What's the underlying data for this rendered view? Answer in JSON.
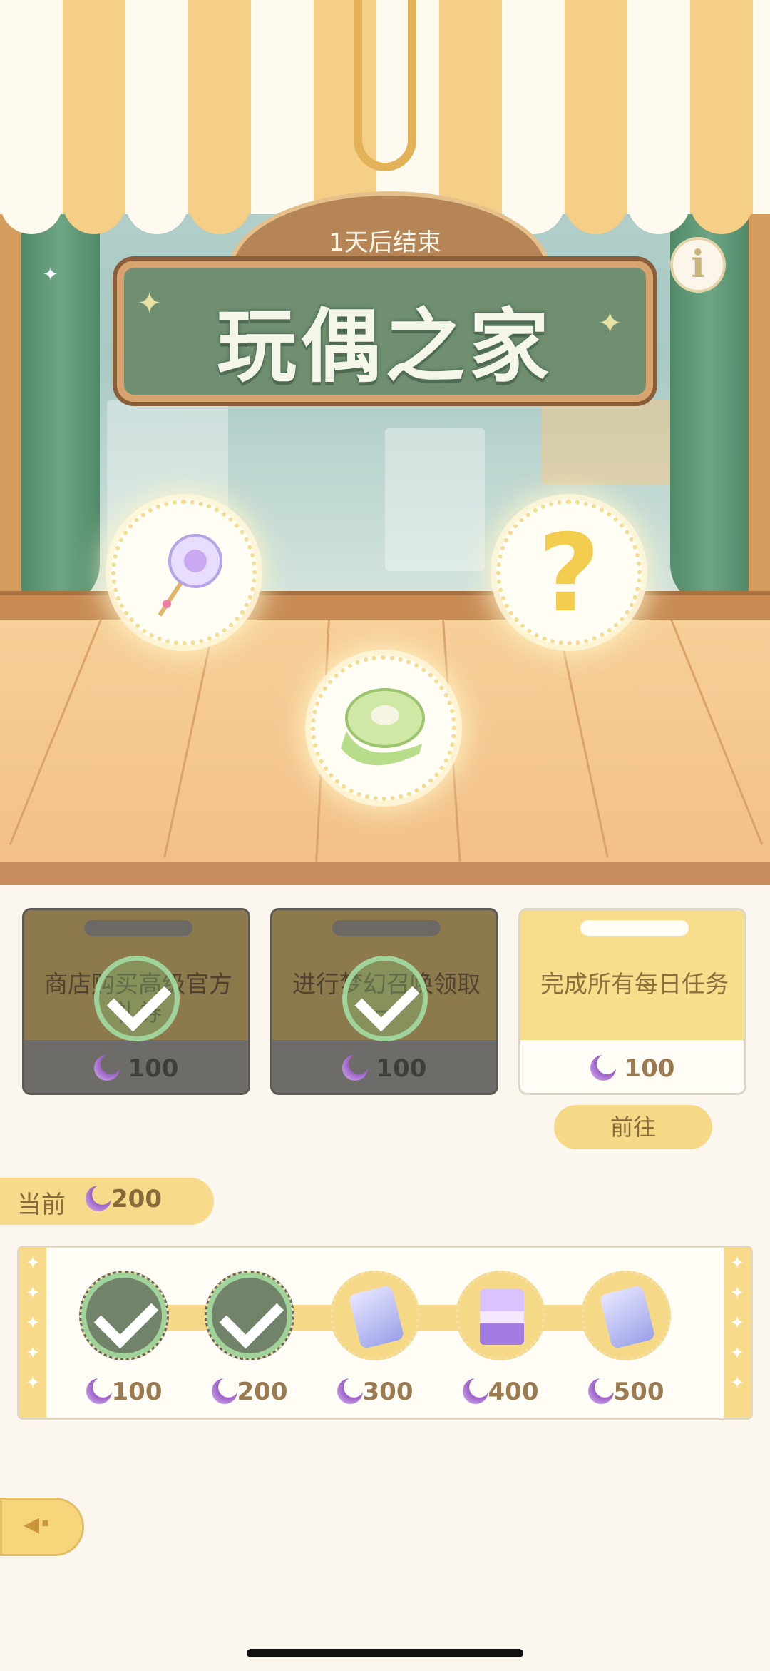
{
  "event": {
    "timer": "1天后结束",
    "title": "玩偶之家"
  },
  "rewards_showcase": [
    {
      "icon": "lollipop-wand-icon"
    },
    {
      "icon": "question-mark-icon",
      "label": "?"
    },
    {
      "icon": "ribbon-spool-icon"
    }
  ],
  "tasks": [
    {
      "desc": "商店购买高级官方礼券",
      "amount": "100",
      "status": "completed"
    },
    {
      "desc": "进行梦幻召唤领取一",
      "amount": "100",
      "status": "completed"
    },
    {
      "desc": "完成所有每日任务",
      "amount": "100",
      "status": "open"
    }
  ],
  "go_button": "前往",
  "progress": {
    "current_label": "当前",
    "current_value": "200",
    "milestones": [
      {
        "amount": "100",
        "item": "claimed-check-icon",
        "claimed": true
      },
      {
        "amount": "200",
        "item": "claimed-check-icon",
        "claimed": true
      },
      {
        "amount": "300",
        "item": "ticket-icon",
        "claimed": false
      },
      {
        "amount": "400",
        "item": "hourglass-icon",
        "claimed": false
      },
      {
        "amount": "500",
        "item": "ticket-icon",
        "claimed": false
      }
    ]
  },
  "colors": {
    "accent": "#f5d987",
    "moon": "#9a60c6",
    "text_brown": "#9b7a4f"
  }
}
